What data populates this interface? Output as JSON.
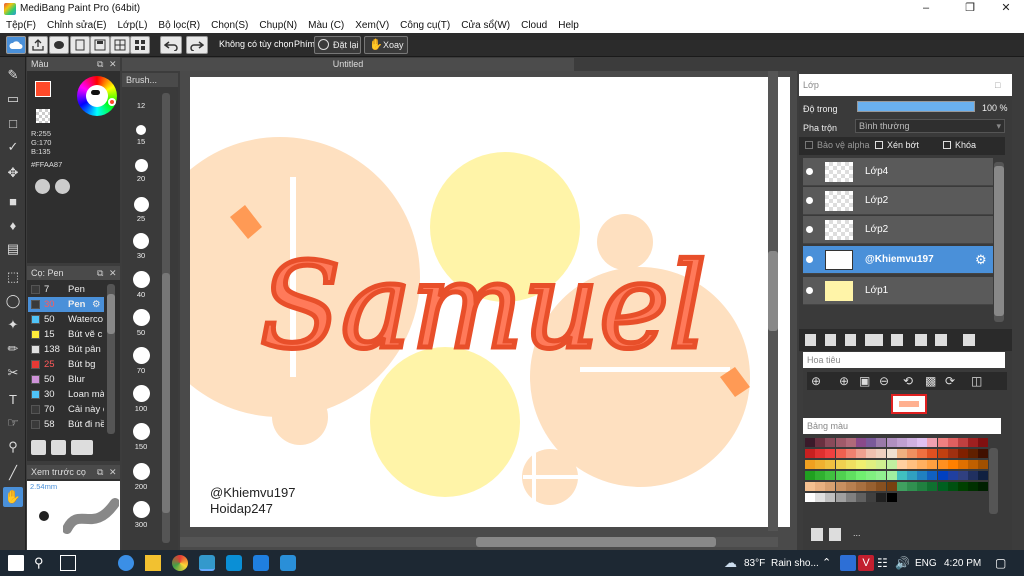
{
  "window": {
    "title": "MediBang Paint Pro (64bit)",
    "doc_tab": "Untitled"
  },
  "menu": [
    "Tệp(F)",
    "Chỉnh sửa(E)",
    "Lớp(L)",
    "Bộ lọc(R)",
    "Chọn(S)",
    "Chụp(N)",
    "Màu (C)",
    "Xem(V)",
    "Công cụ(T)",
    "Cửa sổ(W)",
    "Cloud",
    "Help"
  ],
  "toolbar": {
    "option_text": "Không có tùy chọn",
    "key_label": "Phím",
    "reset_label": "Đặt lại",
    "rotate_label": "Xoay"
  },
  "color_panel": {
    "title": "Màu",
    "r": "R:255",
    "g": "G:170",
    "b": "B:135",
    "hex": "#FFAA87",
    "fg_color": "#ff4a2a",
    "bg_color": "#ffffff"
  },
  "brush_panel": {
    "title": "Cọ: Pen",
    "items": [
      {
        "size": "7",
        "name": "Pen",
        "color": "#3a3a3a"
      },
      {
        "size": "30",
        "name": "Pen",
        "color": "#3a3a3a"
      },
      {
        "size": "50",
        "name": "Waterco",
        "color": "#4fc3f7"
      },
      {
        "size": "15",
        "name": "Bút vẽ c",
        "color": "#ffeb3b"
      },
      {
        "size": "138",
        "name": "Bút pân",
        "color": "#e0e0e0"
      },
      {
        "size": "25",
        "name": "Bút bg",
        "color": "#e53935"
      },
      {
        "size": "50",
        "name": "Blur",
        "color": "#ce93d8"
      },
      {
        "size": "30",
        "name": "Loan mà",
        "color": "#4fc3f7"
      },
      {
        "size": "70",
        "name": "Cải này c",
        "color": "#3a3a3a"
      },
      {
        "size": "58",
        "name": "Bút đi nề",
        "color": "#3a3a3a"
      }
    ],
    "selected_index": 1
  },
  "preview_panel": {
    "title": "Xem trước cọ",
    "size_text": "2.54mm"
  },
  "size_strip": {
    "title": "Brush...",
    "sizes": [
      "12",
      "15",
      "20",
      "25",
      "30",
      "40",
      "50",
      "70",
      "100",
      "150",
      "200",
      "300"
    ]
  },
  "canvas": {
    "main_text": "Samuel",
    "credit_1": "@Khiemvu197",
    "credit_2": "Hoidap247"
  },
  "layer_panel": {
    "title": "Lớp",
    "opacity_label": "Độ trong",
    "opacity_value": "100 %",
    "blend_label": "Pha trộn",
    "blend_value": "Bình thường",
    "protect_alpha": "Bảo vệ alpha",
    "clipping": "Xén bớt",
    "lock": "Khóa",
    "layers": [
      {
        "name": "Lớp4"
      },
      {
        "name": "Lớp2"
      },
      {
        "name": "Lớp2"
      },
      {
        "name": "@Khiemvu197"
      },
      {
        "name": "Lớp1"
      }
    ],
    "selected_index": 3
  },
  "navigator": {
    "title": "Hoa tiêu"
  },
  "palette": {
    "title": "Bảng màu",
    "more": "...",
    "colors": [
      "#3a1a2a",
      "#6a3040",
      "#8a4a5a",
      "#a05a6a",
      "#b06a7a",
      "#8a4a8a",
      "#7a5a9a",
      "#9a7aaa",
      "#b090c0",
      "#c0a0d0",
      "#d0b0e0",
      "#e0c0f0",
      "#f0a0b0",
      "#f08080",
      "#e06060",
      "#c04040",
      "#a02020",
      "#801010",
      "#c82020",
      "#e03030",
      "#f04040",
      "#f06050",
      "#f08070",
      "#f0a090",
      "#f0c0b0",
      "#f0d0c0",
      "#f0e0d0",
      "#f0b080",
      "#f09060",
      "#f07040",
      "#e05020",
      "#c04010",
      "#a03010",
      "#802000",
      "#602000",
      "#401000",
      "#f0a020",
      "#f0b030",
      "#f0c040",
      "#f0d050",
      "#f0e060",
      "#f0f070",
      "#e0f080",
      "#d0f090",
      "#c0f0a0",
      "#ffd0a0",
      "#ffc080",
      "#ffb060",
      "#ffa040",
      "#ff9020",
      "#ff8000",
      "#e07000",
      "#c06000",
      "#a05000",
      "#20a020",
      "#30b030",
      "#40c040",
      "#50d050",
      "#60e060",
      "#70f070",
      "#80f080",
      "#90f090",
      "#a0f0a0",
      "#40c0c0",
      "#30a0c0",
      "#2080c0",
      "#1060c0",
      "#0040c0",
      "#2040a0",
      "#304080",
      "#203060",
      "#102040",
      "#f4c090",
      "#e8b080",
      "#d8a070",
      "#c89060",
      "#b88050",
      "#a87040",
      "#986030",
      "#885020",
      "#784010",
      "#40a060",
      "#309050",
      "#208040",
      "#107030",
      "#006020",
      "#005010",
      "#004000",
      "#003000",
      "#002000",
      "#ffffff",
      "#e0e0e0",
      "#c0c0c0",
      "#a0a0a0",
      "#808080",
      "#606060",
      "#404040",
      "#202020",
      "#000000"
    ]
  },
  "taskbar": {
    "temp": "83°F",
    "weather": "Rain sho...",
    "lang": "ENG",
    "time": "4:20 PM"
  }
}
